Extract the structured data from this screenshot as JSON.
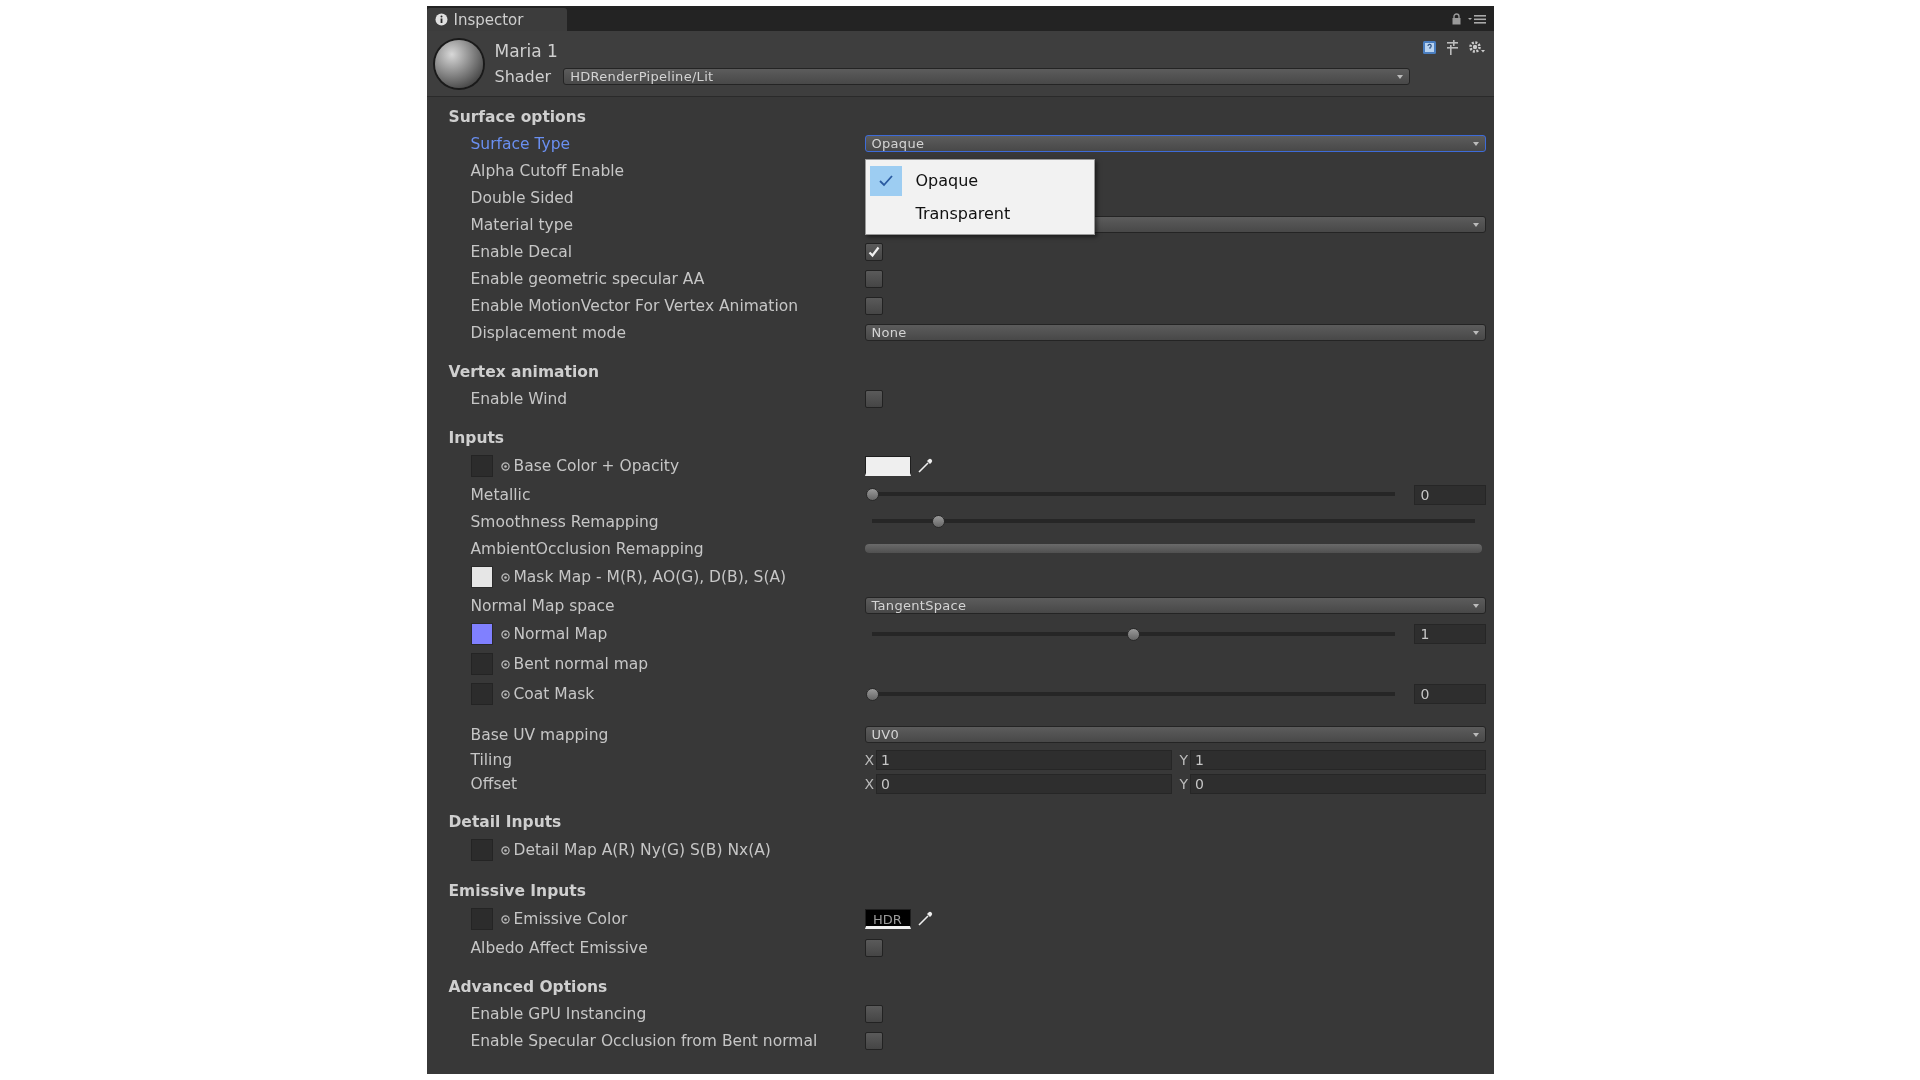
{
  "tab": {
    "title": "Inspector"
  },
  "material": {
    "name": "Maria 1",
    "shader_label": "Shader",
    "shader": "HDRenderPipeline/Lit"
  },
  "sections": [
    {
      "title": "Surface options",
      "rows": [
        {
          "kind": "dropdown",
          "label": "Surface Type",
          "focused": true,
          "value": "Opaque",
          "menu": {
            "options": [
              {
                "label": "Opaque",
                "selected": true
              },
              {
                "label": "Transparent",
                "selected": false
              }
            ]
          }
        },
        {
          "kind": "label",
          "label": "Alpha Cutoff Enable"
        },
        {
          "kind": "label",
          "label": "Double Sided"
        },
        {
          "kind": "dropdown",
          "label": "Material type",
          "focused": false
        },
        {
          "kind": "checkbox",
          "label": "Enable Decal",
          "checked": true
        },
        {
          "kind": "checkbox",
          "label": "Enable geometric specular AA",
          "checked": false
        },
        {
          "kind": "checkbox",
          "label": "Enable MotionVector For Vertex Animation",
          "checked": false
        },
        {
          "kind": "dropdown",
          "label": "Displacement mode",
          "focused": false,
          "value": "None"
        }
      ]
    },
    {
      "title": "Vertex animation",
      "rows": [
        {
          "kind": "checkbox",
          "label": "Enable Wind",
          "checked": false
        }
      ]
    },
    {
      "title": "Inputs",
      "rows": [
        {
          "kind": "texture",
          "label": "Base Color + Opacity",
          "swatch": {
            "color": "#efefef"
          }
        },
        {
          "kind": "slider",
          "label": "Metallic",
          "level": 0,
          "value": "0"
        },
        {
          "kind": "slider",
          "label": "Smoothness Remapping",
          "level": 0.11
        },
        {
          "kind": "range",
          "label": "AmbientOcclusion Remapping",
          "level": 1
        },
        {
          "kind": "texture",
          "color": "#e6e6e6",
          "label": "Mask Map - M(R), AO(G), D(B), S(A)"
        },
        {
          "kind": "dropdown",
          "label": "Normal Map space",
          "focused": false,
          "value": "TangentSpace"
        },
        {
          "kind": "texture",
          "color": "#8080ff",
          "label": "Normal Map",
          "slider": {
            "level": 0.5,
            "value": "1"
          }
        },
        {
          "kind": "texture",
          "label": "Bent normal map"
        },
        {
          "kind": "texture",
          "label": "Coat Mask",
          "slider": {
            "level": 0,
            "value": "0"
          }
        }
      ]
    },
    {
      "rows": [
        {
          "kind": "dropdown",
          "label": "Base UV mapping",
          "focused": false,
          "value": "UV0"
        },
        {
          "kind": "vector",
          "label": "Tiling",
          "fields": [
            {
              "axis": "X",
              "value": "1"
            },
            {
              "axis": "Y",
              "value": "1"
            }
          ]
        },
        {
          "kind": "vector",
          "label": "Offset",
          "fields": [
            {
              "axis": "X",
              "value": "0"
            },
            {
              "axis": "Y",
              "value": "0"
            }
          ]
        }
      ]
    },
    {
      "title": "Detail Inputs",
      "rows": [
        {
          "kind": "texture",
          "label": "Detail Map A(R) Ny(G) S(B) Nx(A)"
        }
      ]
    },
    {
      "title": "Emissive Inputs",
      "rows": [
        {
          "kind": "texture",
          "label": "Emissive Color",
          "swatch": {
            "color": "#000000",
            "label": "HDR"
          }
        },
        {
          "kind": "checkbox",
          "label": "Albedo Affect Emissive",
          "checked": false
        }
      ]
    },
    {
      "title": "Advanced Options",
      "rows": [
        {
          "kind": "checkbox",
          "label": "Enable GPU Instancing",
          "checked": false
        },
        {
          "kind": "checkbox",
          "label": "Enable Specular Occlusion from Bent normal",
          "checked": false
        }
      ]
    }
  ]
}
